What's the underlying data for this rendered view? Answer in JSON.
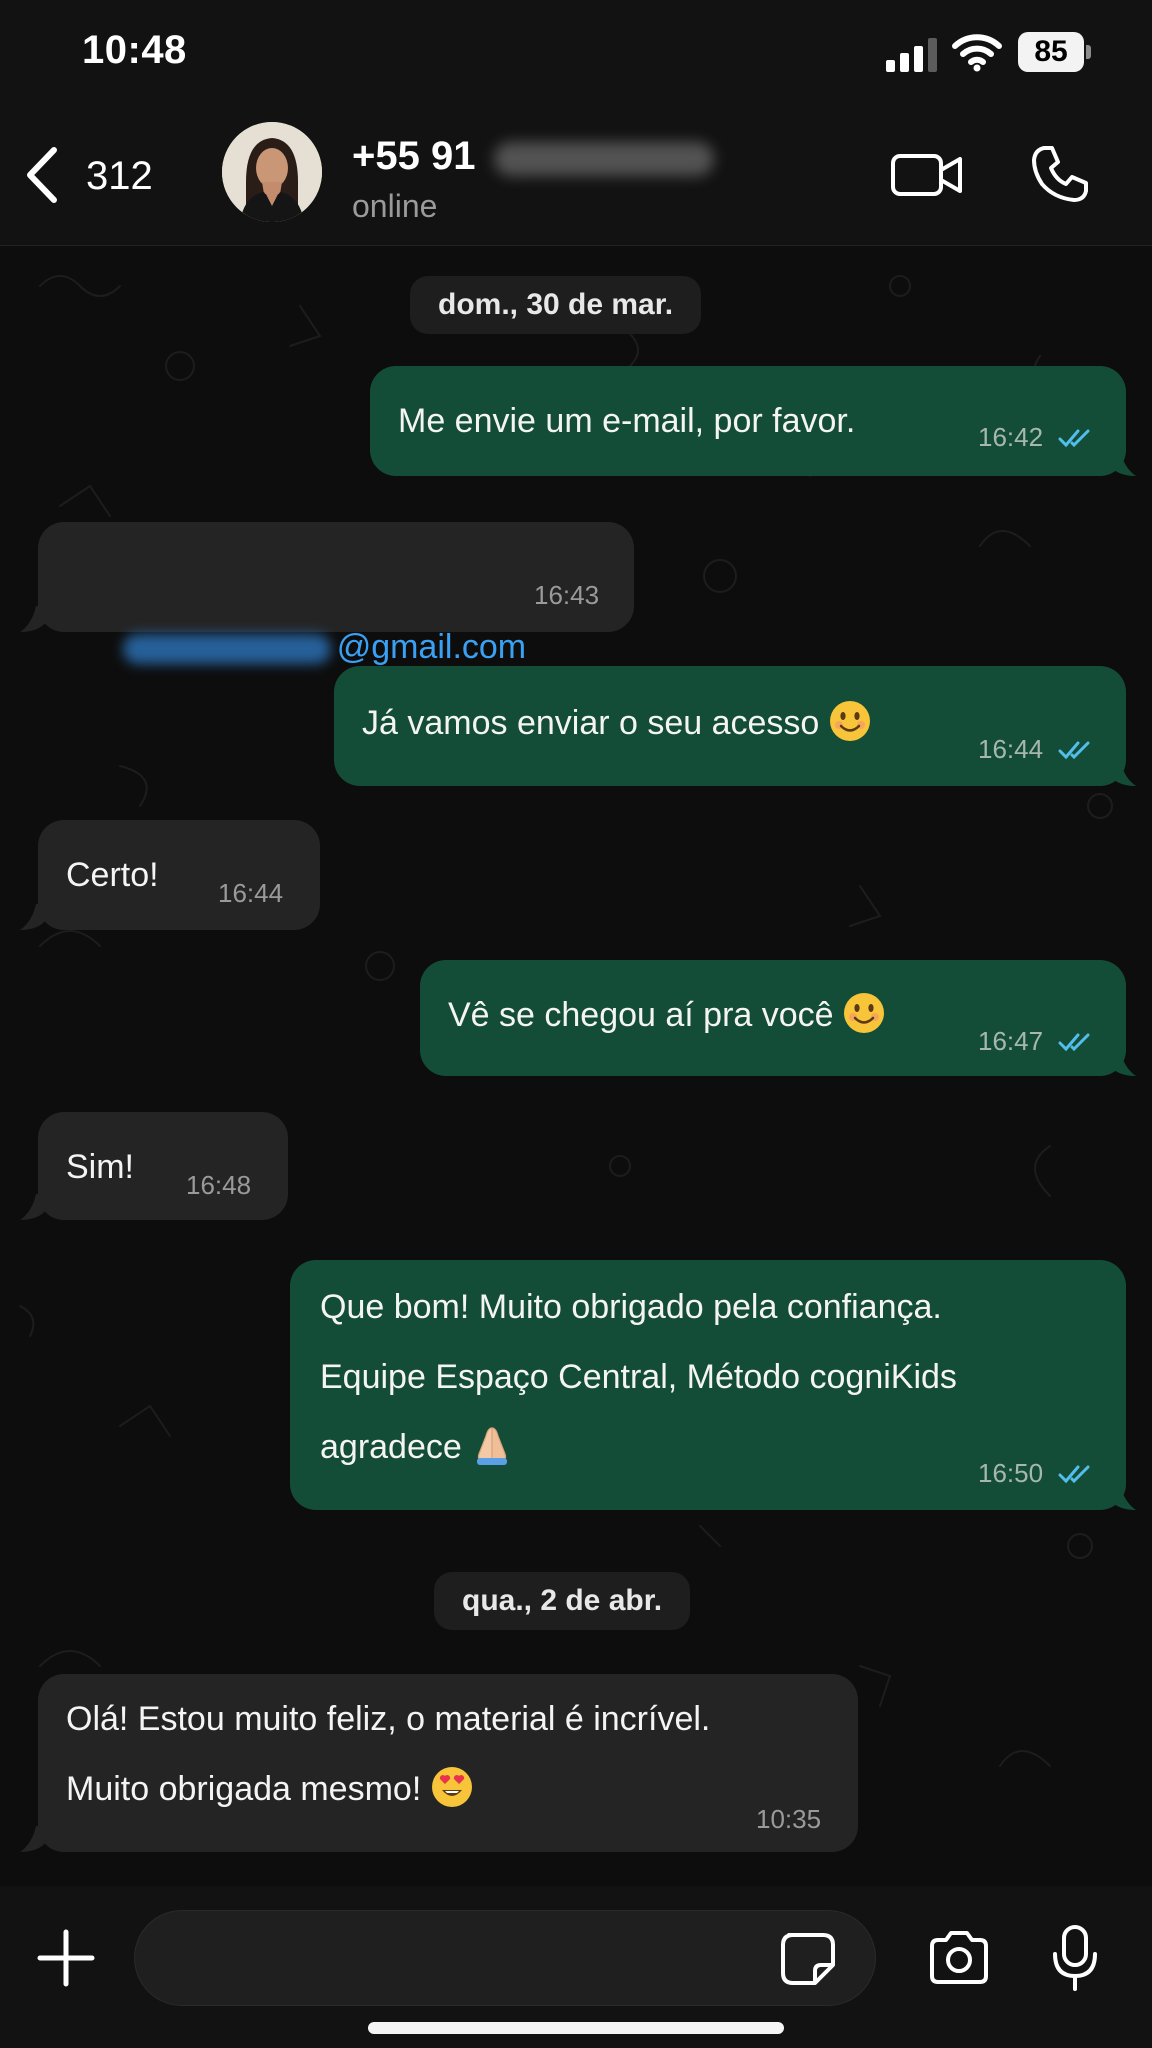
{
  "status_bar": {
    "time": "10:48",
    "battery": "85"
  },
  "header": {
    "back_count": "312",
    "contact_name": "+55 91",
    "contact_status": "online"
  },
  "messages": [
    {
      "type": "date",
      "text": "dom., 30 de mar."
    },
    {
      "type": "out",
      "text": "Me envie um e-mail, por favor.",
      "time": "16:42",
      "read": true
    },
    {
      "type": "in",
      "text": "@gmail.com",
      "time": "16:43"
    },
    {
      "type": "out",
      "text": "Já vamos enviar o seu acesso",
      "emoji": "smiling-face",
      "time": "16:44",
      "read": true
    },
    {
      "type": "in",
      "text": "Certo!",
      "time": "16:44"
    },
    {
      "type": "out",
      "text": "Vê se chegou aí pra você",
      "emoji": "smiling-face",
      "time": "16:47",
      "read": true
    },
    {
      "type": "in",
      "text": "Sim!",
      "time": "16:48"
    },
    {
      "type": "out",
      "lines": [
        "Que bom! Muito obrigado pela confiança.",
        "Equipe Espaço Central, Método cogniKids",
        "agradece"
      ],
      "emoji": "folded-hands",
      "time": "16:50",
      "read": true
    },
    {
      "type": "date",
      "text": "qua., 2 de abr."
    },
    {
      "type": "in",
      "lines": [
        "Olá! Estou muito feliz, o material é incrível.",
        "Muito obrigada mesmo!"
      ],
      "emoji": "heart-eyes-face",
      "time": "10:35"
    }
  ],
  "colors": {
    "outgoing_bubble": "#144d37",
    "incoming_bubble": "#242424",
    "read_ticks": "#53bdeb",
    "link": "#3aa0f3"
  },
  "icons": {
    "back": "chevron-left-icon",
    "video": "video-camera-icon",
    "call": "phone-icon",
    "attach": "plus-icon",
    "sticker": "sticker-icon",
    "camera": "camera-icon",
    "mic": "microphone-icon"
  }
}
